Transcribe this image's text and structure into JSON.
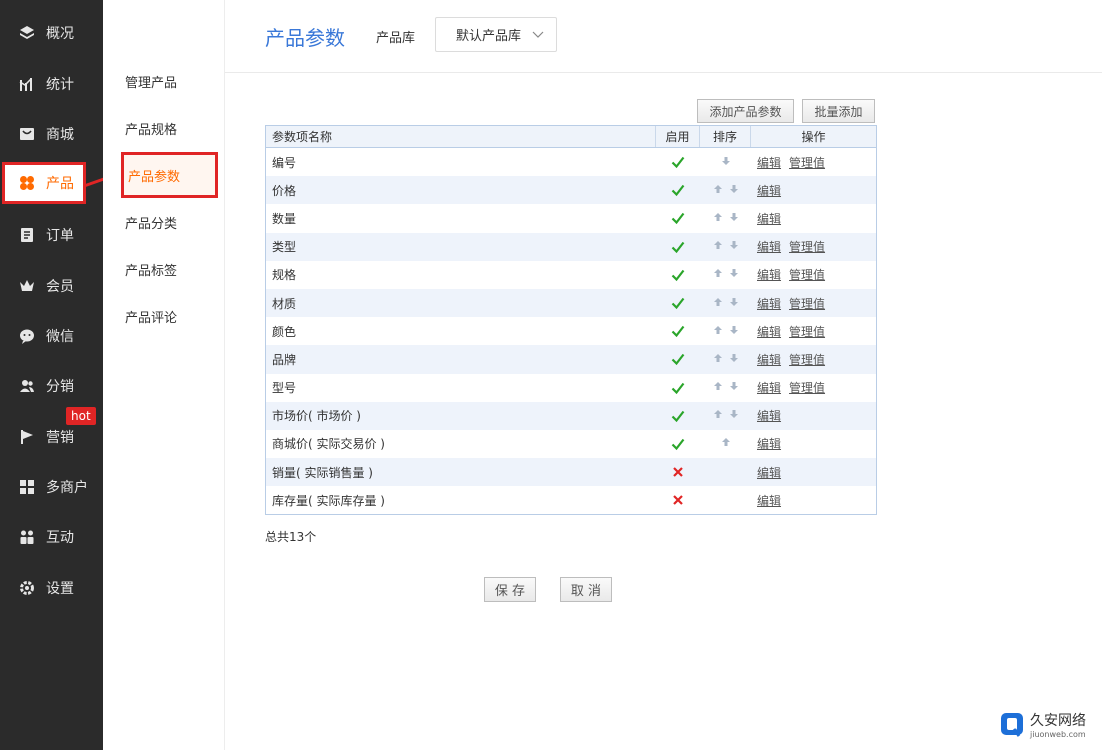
{
  "nav": {
    "items": [
      {
        "label": "概况",
        "icon": "layers-icon"
      },
      {
        "label": "统计",
        "icon": "chart-icon"
      },
      {
        "label": "商城",
        "icon": "shop-icon"
      },
      {
        "label": "产品",
        "icon": "product-icon"
      },
      {
        "label": "订单",
        "icon": "order-icon"
      },
      {
        "label": "会员",
        "icon": "crown-icon"
      },
      {
        "label": "微信",
        "icon": "wechat-icon"
      },
      {
        "label": "分销",
        "icon": "users-icon"
      },
      {
        "label": "营销",
        "icon": "flag-icon"
      },
      {
        "label": "多商户",
        "icon": "grid-icon"
      },
      {
        "label": "互动",
        "icon": "people-icon"
      },
      {
        "label": "设置",
        "icon": "gear-icon"
      }
    ],
    "hot_badge": "hot"
  },
  "subnav": {
    "items": [
      "管理产品",
      "产品规格",
      "产品参数",
      "产品分类",
      "产品标签",
      "产品评论"
    ]
  },
  "header": {
    "title": "产品参数",
    "lib_label": "产品库",
    "lib_value": "默认产品库"
  },
  "toolbar": {
    "add_param": "添加产品参数",
    "batch_add": "批量添加"
  },
  "table": {
    "headers": {
      "name": "参数项名称",
      "enabled": "启用",
      "sort": "排序",
      "ops": "操作"
    },
    "rows": [
      {
        "name": "编号",
        "enabled": true,
        "up": false,
        "down": true,
        "edit": "编辑",
        "manage": "管理值"
      },
      {
        "name": "价格",
        "enabled": true,
        "up": true,
        "down": true,
        "edit": "编辑",
        "manage": ""
      },
      {
        "name": "数量",
        "enabled": true,
        "up": true,
        "down": true,
        "edit": "编辑",
        "manage": ""
      },
      {
        "name": "类型",
        "enabled": true,
        "up": true,
        "down": true,
        "edit": "编辑",
        "manage": "管理值"
      },
      {
        "name": "规格",
        "enabled": true,
        "up": true,
        "down": true,
        "edit": "编辑",
        "manage": "管理值"
      },
      {
        "name": "材质",
        "enabled": true,
        "up": true,
        "down": true,
        "edit": "编辑",
        "manage": "管理值"
      },
      {
        "name": "颜色",
        "enabled": true,
        "up": true,
        "down": true,
        "edit": "编辑",
        "manage": "管理值"
      },
      {
        "name": "品牌",
        "enabled": true,
        "up": true,
        "down": true,
        "edit": "编辑",
        "manage": "管理值"
      },
      {
        "name": "型号",
        "enabled": true,
        "up": true,
        "down": true,
        "edit": "编辑",
        "manage": "管理值"
      },
      {
        "name": "市场价( 市场价 )",
        "enabled": true,
        "up": true,
        "down": true,
        "edit": "编辑",
        "manage": ""
      },
      {
        "name": "商城价( 实际交易价 )",
        "enabled": true,
        "up": true,
        "down": false,
        "edit": "编辑",
        "manage": ""
      },
      {
        "name": "销量( 实际销售量 )",
        "enabled": false,
        "up": false,
        "down": false,
        "edit": "编辑",
        "manage": ""
      },
      {
        "name": "库存量( 实际库存量 )",
        "enabled": false,
        "up": false,
        "down": false,
        "edit": "编辑",
        "manage": ""
      }
    ]
  },
  "total_text": "总共13个",
  "actions": {
    "save": "保 存",
    "cancel": "取 消"
  },
  "watermark": {
    "main": "久安网络",
    "sub": "jiuonweb.com"
  },
  "colors": {
    "accent": "#3a78d8",
    "active": "#ff6a00",
    "highlight": "#e02525",
    "check": "#2aa52a",
    "cross": "#e02525"
  }
}
